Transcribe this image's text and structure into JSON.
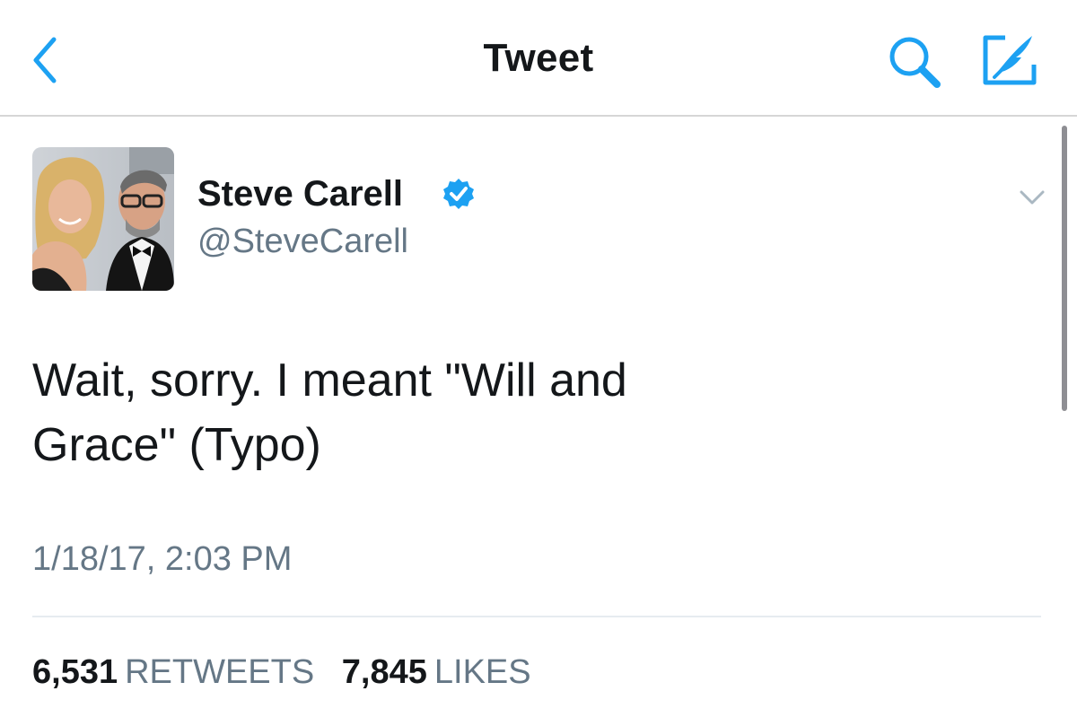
{
  "nav": {
    "title": "Tweet",
    "back_icon": "chevron-left-icon",
    "search_icon": "search-icon",
    "compose_icon": "compose-icon",
    "accent_color": "#1da1f2"
  },
  "tweet": {
    "author_name": "Steve Carell",
    "verified": true,
    "author_handle": "@SteveCarell",
    "menu_icon": "chevron-down-icon",
    "text_line1": "Wait, sorry. I meant \"Will and",
    "text_line2": "Grace\" (Typo)",
    "timestamp": "1/18/17, 2:03 PM"
  },
  "stats": {
    "retweets_count": "6,531",
    "retweets_label": "RETWEETS",
    "likes_count": "7,845",
    "likes_label": "LIKES"
  }
}
